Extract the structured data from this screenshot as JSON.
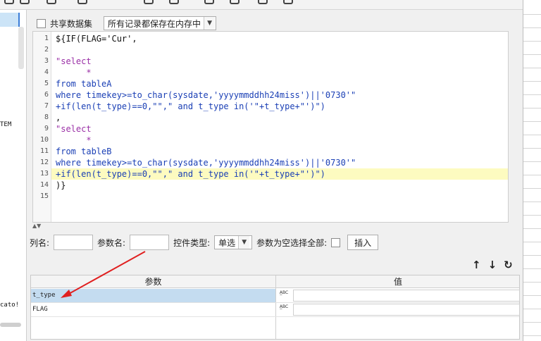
{
  "options": {
    "shared_dataset_label": "共享数据集",
    "storage_mode": "所有记录都保存在内存中"
  },
  "left_panel": {
    "fragment_1": "TEM",
    "fragment_2": "cato!"
  },
  "editor": {
    "lines": [
      {
        "n": "1",
        "text": "${IF(FLAG='Cur',"
      },
      {
        "n": "2",
        "text": ""
      },
      {
        "n": "3",
        "text": "\"select"
      },
      {
        "n": "4",
        "text": "      *"
      },
      {
        "n": "5",
        "text": "from tableA"
      },
      {
        "n": "6",
        "text": "where timekey>=to_char(sysdate,'yyyymmddhh24miss')||'0730'\""
      },
      {
        "n": "7",
        "text": "+if(len(t_type)==0,\"\",\" and t_type in('\"+t_type+\"')\")"
      },
      {
        "n": "8",
        "text": ","
      },
      {
        "n": "9",
        "text": "\"select"
      },
      {
        "n": "10",
        "text": "      *"
      },
      {
        "n": "11",
        "text": "from tableB"
      },
      {
        "n": "12",
        "text": "where timekey>=to_char(sysdate,'yyyymmddhh24miss')||'0730'\""
      },
      {
        "n": "13",
        "text": "+if(len(t_type)==0,\"\",\" and t_type in('\"+t_type+\"')\")"
      },
      {
        "n": "14",
        "text": ")}"
      },
      {
        "n": "15",
        "text": ""
      }
    ],
    "highlight_line": "13"
  },
  "param_row": {
    "col_name_label": "列名:",
    "param_name_label": "参数名:",
    "control_type_label": "控件类型:",
    "control_type_value": "单选",
    "empty_select_all_label": "参数为空选择全部:",
    "insert_button": "插入"
  },
  "param_table": {
    "header_param": "参数",
    "header_value": "值",
    "rows": [
      {
        "name": "t_type",
        "type_icon": "A̲BC",
        "value": ""
      },
      {
        "name": "FLAG",
        "type_icon": "A̲BC",
        "value": ""
      }
    ]
  },
  "colors": {
    "annotation_arrow": "#e02020",
    "highlight_line": "#fdfbc0",
    "selected_row": "#c4dcf0"
  }
}
